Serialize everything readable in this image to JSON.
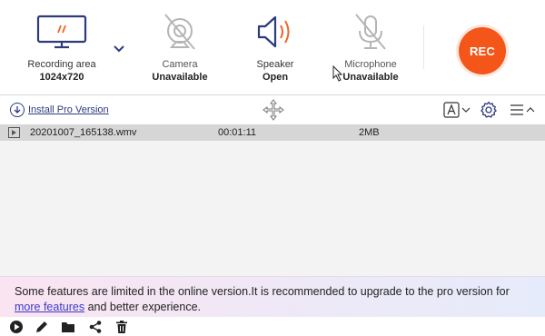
{
  "toolbar": {
    "recording_area": {
      "label": "Recording area",
      "value": "1024x720",
      "icon": "monitor-icon"
    },
    "camera": {
      "label": "Camera",
      "value": "Unavailable",
      "icon": "camera-disabled-icon"
    },
    "speaker": {
      "label": "Speaker",
      "value": "Open",
      "icon": "speaker-icon"
    },
    "microphone": {
      "label": "Microphone",
      "value": "Unavailable",
      "icon": "microphone-disabled-icon"
    },
    "rec_label": "REC"
  },
  "subbar": {
    "install_label": "Install Pro Version"
  },
  "files": [
    {
      "name": "20201007_165138.wmv",
      "duration": "00:01:11",
      "size": "2MB"
    }
  ],
  "notice": {
    "text_before": "Some features are limited in the online version.It is recommended to upgrade to the pro version for ",
    "link": "more features",
    "text_after": " and better experience."
  },
  "bottom_icons": [
    "play-icon",
    "edit-icon",
    "folder-icon",
    "share-icon",
    "trash-icon"
  ],
  "colors": {
    "accent_navy": "#2d3a7c",
    "rec_orange": "#f4561a",
    "speaker_orange": "#f0662a",
    "disabled_gray": "#b5b5b5",
    "link_blue": "#3c39c9"
  }
}
